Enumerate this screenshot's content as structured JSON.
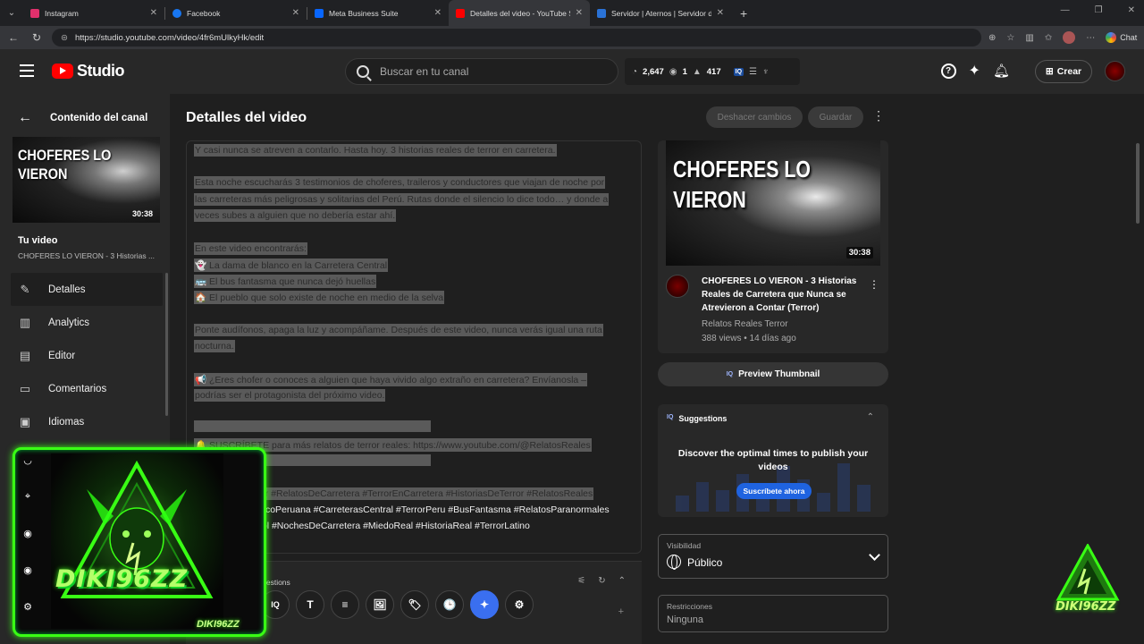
{
  "browser": {
    "tabs": [
      {
        "label": "Instagram",
        "color": "#e1306c"
      },
      {
        "label": "Facebook",
        "color": "#1877f2"
      },
      {
        "label": "Meta Business Suite",
        "color": "#0866ff"
      },
      {
        "label": "Detalles del video - YouTube Studi",
        "color": "#ff0000",
        "active": true
      },
      {
        "label": "Servidor | Aternos | Servidor de M",
        "color": "#2a72d6"
      }
    ],
    "url": "https://studio.youtube.com/video/4fr6mUlkyHk/edit",
    "chat_label": "Chat"
  },
  "header": {
    "logo_text": "Studio",
    "search_placeholder": "Buscar en tu canal",
    "stats": {
      "subscribers": "2,647",
      "views": "1",
      "likes": "417"
    },
    "create_label": "Crear"
  },
  "sidebar": {
    "back_label": "Contenido del canal",
    "thumb_title": "CHOFERES LO VIERON",
    "thumb_duration": "30:38",
    "your_video_label": "Tu video",
    "your_video_title": "CHOFERES LO VIERON - 3 Historias ...",
    "items": [
      {
        "label": "Detalles",
        "icon": "pencil-icon",
        "active": true
      },
      {
        "label": "Analytics",
        "icon": "analytics-icon"
      },
      {
        "label": "Editor",
        "icon": "editor-icon"
      },
      {
        "label": "Comentarios",
        "icon": "comments-icon"
      },
      {
        "label": "Idiomas",
        "icon": "subtitles-icon"
      }
    ]
  },
  "main": {
    "title": "Detalles del video",
    "undo_label": "Deshacer cambios",
    "save_label": "Guardar",
    "description_lines": [
      "Y casi nunca se atreven a contarlo. Hasta hoy. 3 historias reales de terror en carretera.",
      "",
      "Esta noche escucharás 3 testimonios de choferes, traileros y conductores que viajan de noche por",
      "las carreteras más peligrosas y solitarias del Perú. Rutas donde el silencio lo dice todo… y donde a",
      "veces subes a alguien que no debería estar ahí.",
      "",
      "En este video encontrarás:",
      "👻 La dama de blanco en la Carretera Central",
      "🚌 El bus fantasma que nunca dejó huellas",
      "🏠 El pueblo que solo existe de noche en medio de la selva",
      "",
      "Ponte audífonos, apaga la luz y acompáñame. Después de este video, nunca verás igual una ruta",
      "nocturna.",
      "",
      "📢 ¿Eres chofer o conoces a alguien que haya vivido algo extraño en carretera? Envíanosla –",
      "podrías ser el protagonista del próximo video.",
      "",
      "",
      "🔔 SUSCRÍBETE para más relatos de terror reales: https://www.youtube.com/@RelatosReales",
      "",
      "",
      "#RelatosDeTerror #RelatosDeCarretera #TerrorEnCarretera #HistoriasDeTerror #RelatosReales",
      "#LaDamaDeBlancoPeruana #CarreterasCentral #TerrorPeru #BusFantasma #RelatosParanormales",
      "#TerrorEnEspañol #NochesDeCarretera #MiedoReal #HistoriaReal #TerrorLatino"
    ],
    "suggestions_label": "Suggestions",
    "toolbar": [
      "IQ",
      "T",
      "≡",
      "🖼",
      "🏷",
      "🕒",
      "✦",
      "⚙"
    ]
  },
  "preview": {
    "thumb_title": "CHOFERES LO VIERON",
    "duration": "30:38",
    "title": "CHOFERES LO VIERON - 3 Historias Reales de Carretera que Nunca se Atrevieron a Contar (Terror)",
    "channel": "Relatos Reales Terror",
    "meta": "388 views • 14 días ago",
    "button_label": "Preview Thumbnail",
    "iq_badge": "IQ"
  },
  "suggestions": {
    "title": "Suggestions",
    "text": "Discover the optimal times to publish your videos",
    "cta": "Suscríbete ahora"
  },
  "visibility": {
    "label": "Visibilidad",
    "value": "Público"
  },
  "restrictions": {
    "label": "Restricciones",
    "value": "Ninguna"
  },
  "overlay": {
    "name": "DIKI96ZZ",
    "tag": "DIKI96ZZ",
    "corner_text": "DIKI96ZZ",
    "accent": "#39ff14"
  }
}
